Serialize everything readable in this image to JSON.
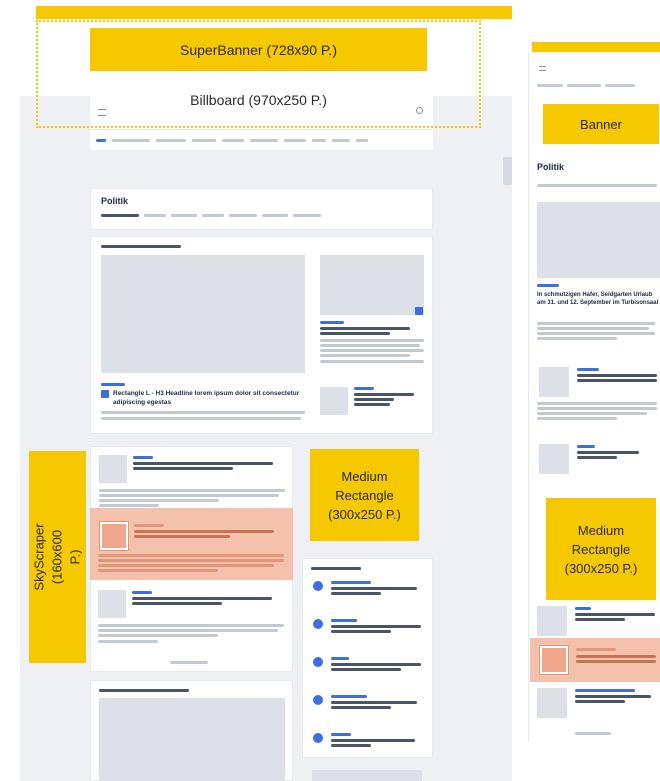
{
  "ads": {
    "superbanner": "SuperBanner (728x90 P.)",
    "billboard": "Billboard (970x250 P.)",
    "banner": "Banner",
    "medium_rect_desktop": "Medium Rectangle (300x250 P.)",
    "medium_rect_mobile": "Medium Rectangle (300x250 P.)",
    "skyscraper": "SkyScraper (160x600 P.)"
  },
  "desktop": {
    "section_title": "Politik",
    "headline": "Rectangle L - H3 Headline lorem ipsum dolor sit consectetur adipiscing egestas"
  },
  "mobile": {
    "section_title": "Politik",
    "headline": "In schmutzigen Hafer, Seidgarten Urlaub am 31. und 12. September im Turbisonsaal"
  },
  "colors": {
    "ad_yellow": "#f6c800",
    "highlight": "#f4c1ad",
    "accent_blue": "#3d6fe0",
    "placeholder_gray": "#dde1e7"
  }
}
